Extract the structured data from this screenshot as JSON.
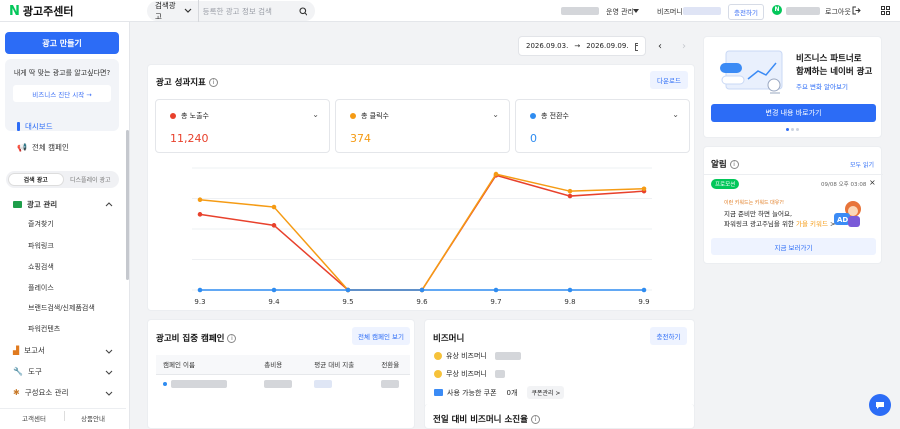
{
  "header": {
    "logo_letter": "N",
    "logo_text": "광고주센터",
    "search_type": "검색광고",
    "search_placeholder": "등록한 광고 정보 검색",
    "operation_label": "운영 관리",
    "bizmoney_label": "비즈머니",
    "charge_label": "충전하기",
    "naver_letter": "N",
    "logout_label": "로그아웃"
  },
  "sidebar": {
    "create_ad": "광고 만들기",
    "recommend_text": "내게 딱 맞는 광고를 알고싶다면?",
    "diagnosis_button": "비즈니스 진단 시작 →",
    "dashboard": "대시보드",
    "all_campaigns": "전체 캠페인",
    "toggle_search": "검색 광고",
    "toggle_display": "디스플레이 광고",
    "ad_management": "광고 관리",
    "sub_items": [
      "즐겨찾기",
      "파워링크",
      "쇼핑검색",
      "플레이스",
      "브랜드검색/신제품검색",
      "파워컨텐츠"
    ],
    "reports": "보고서",
    "tools": "도구",
    "components": "구성요소 관리",
    "footer_left": "고객센터",
    "footer_right": "상품안내"
  },
  "date_range": {
    "start": "2026.09.03.",
    "arrow": "→",
    "end": "2026.09.09."
  },
  "performance": {
    "title": "광고 성과지표",
    "download": "다운로드",
    "metrics": [
      {
        "label": "총 노출수",
        "value": "11,240",
        "color": "#e8412c"
      },
      {
        "label": "총 클릭수",
        "value": "374",
        "color": "#f59b14"
      },
      {
        "label": "총 전환수",
        "value": "0",
        "color": "#2f8cf0"
      }
    ]
  },
  "chart_data": {
    "type": "line",
    "categories": [
      "9.3",
      "9.4",
      "9.5",
      "9.6",
      "9.7",
      "9.8",
      "9.9"
    ],
    "series": [
      {
        "name": "총 노출수",
        "color": "#e8412c",
        "values": [
          0.62,
          0.53,
          0.0,
          0.0,
          0.94,
          0.77,
          0.81
        ]
      },
      {
        "name": "총 클릭수",
        "color": "#f59b14",
        "values": [
          0.74,
          0.68,
          0.0,
          0.0,
          0.95,
          0.81,
          0.83
        ]
      },
      {
        "name": "총 전환수",
        "color": "#2f8cf0",
        "values": [
          0,
          0,
          0,
          0,
          0,
          0,
          0
        ]
      }
    ],
    "ylim": [
      0,
      1
    ],
    "grid": true
  },
  "focus_campaign": {
    "title": "광고비 집중 캠페인",
    "view_all": "전체 캠페인 보기",
    "columns": [
      "캠페인 이름",
      "총비용",
      "평균 대비 지출",
      "전환율"
    ]
  },
  "bizmoney": {
    "title": "비즈머니",
    "charge": "충전하기",
    "paid": "유상 비즈머니",
    "free": "무상 비즈머니",
    "coupon_label": "사용 가능한 쿠폰",
    "coupon_count": "0개",
    "coupon_manage": "쿠폰관리 >"
  },
  "yesterday": {
    "title": "전일 대비 비즈머니 소진율"
  },
  "banner": {
    "line1": "비즈니스 파트너로",
    "line2": "함께하는 네이버 광고",
    "link": "주요 변화 알아보기",
    "button": "변경 내용 바로가기"
  },
  "notice": {
    "title": "알림",
    "view_all": "모두 읽기",
    "badge": "프로모션",
    "time": "09/08 오후 03:08",
    "close": "×",
    "small": "이런 키워드는 키워드 대유?!",
    "line1": "지금 준비만 하면 늘어요,",
    "line2_a": "파워링크 광고주님을 위한 ",
    "line2_b": "가을 키워드",
    "line2_c": " >",
    "button": "지금 보러가기",
    "badge_color": "#03c75a"
  }
}
